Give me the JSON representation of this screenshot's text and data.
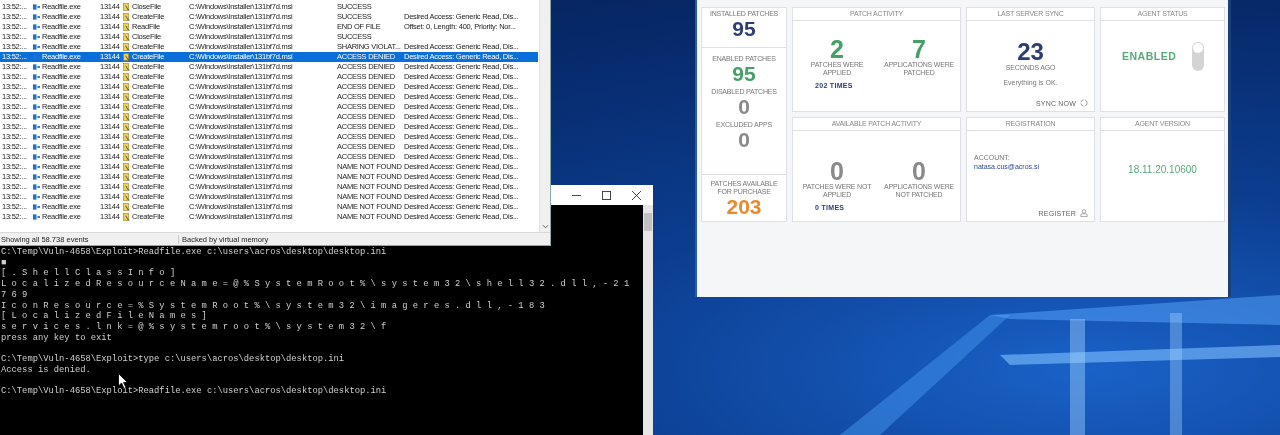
{
  "process_monitor": {
    "rows": [
      {
        "time": "13:52:...",
        "process": "Readfile.exe",
        "pid": "13144",
        "operation": "CloseFile",
        "path": "C:\\Windows\\Installer\\131bf7d.msi",
        "result": "SUCCESS",
        "selected": false
      },
      {
        "time": "13:52:...",
        "process": "Readfile.exe",
        "pid": "13144",
        "operation": "CreateFile",
        "path": "C:\\Windows\\Installer\\131bf7d.msi",
        "result": "SUCCESS",
        "detail": "Desired Access: Generic Read, Dis...",
        "selected": false
      },
      {
        "time": "13:52:...",
        "process": "Readfile.exe",
        "pid": "13144",
        "operation": "ReadFile",
        "path": "C:\\Windows\\Installer\\131bf7d.msi",
        "result": "END OF FILE",
        "detail": "Offset: 0, Length: 400, Priority: Nor...",
        "selected": false
      },
      {
        "time": "13:52:...",
        "process": "Readfile.exe",
        "pid": "13144",
        "operation": "CloseFile",
        "path": "C:\\Windows\\Installer\\131bf7d.msi",
        "result": "SUCCESS",
        "selected": false
      },
      {
        "time": "13:52:...",
        "process": "Readfile.exe",
        "pid": "13144",
        "operation": "CreateFile",
        "path": "C:\\Windows\\Installer\\131bf7d.msi",
        "result": "SHARING VIOLAT...",
        "detail": "Desired Access: Generic Read, Dis...",
        "selected": false
      },
      {
        "time": "13:52:...",
        "process": "Readfile.exe",
        "pid": "13144",
        "operation": "CreateFile",
        "path": "C:\\Windows\\Installer\\131bf7d.msi",
        "result": "ACCESS DENIED",
        "detail": "Desired Access: Generic Read, Dis...",
        "selected": true
      },
      {
        "time": "13:52:...",
        "process": "Readfile.exe",
        "pid": "13144",
        "operation": "CreateFile",
        "path": "C:\\Windows\\Installer\\131bf7d.msi",
        "result": "ACCESS DENIED",
        "detail": "Desired Access: Generic Read, Dis...",
        "selected": false
      },
      {
        "time": "13:52:...",
        "process": "Readfile.exe",
        "pid": "13144",
        "operation": "CreateFile",
        "path": "C:\\Windows\\Installer\\131bf7d.msi",
        "result": "ACCESS DENIED",
        "detail": "Desired Access: Generic Read, Dis...",
        "selected": false
      },
      {
        "time": "13:52:...",
        "process": "Readfile.exe",
        "pid": "13144",
        "operation": "CreateFile",
        "path": "C:\\Windows\\Installer\\131bf7d.msi",
        "result": "ACCESS DENIED",
        "detail": "Desired Access: Generic Read, Dis...",
        "selected": false
      },
      {
        "time": "13:52:...",
        "process": "Readfile.exe",
        "pid": "13144",
        "operation": "CreateFile",
        "path": "C:\\Windows\\Installer\\131bf7d.msi",
        "result": "ACCESS DENIED",
        "detail": "Desired Access: Generic Read, Dis...",
        "selected": false
      },
      {
        "time": "13:52:...",
        "process": "Readfile.exe",
        "pid": "13144",
        "operation": "CreateFile",
        "path": "C:\\Windows\\Installer\\131bf7d.msi",
        "result": "ACCESS DENIED",
        "detail": "Desired Access: Generic Read, Dis...",
        "selected": false
      },
      {
        "time": "13:52:...",
        "process": "Readfile.exe",
        "pid": "13144",
        "operation": "CreateFile",
        "path": "C:\\Windows\\Installer\\131bf7d.msi",
        "result": "ACCESS DENIED",
        "detail": "Desired Access: Generic Read, Dis...",
        "selected": false
      },
      {
        "time": "13:52:...",
        "process": "Readfile.exe",
        "pid": "13144",
        "operation": "CreateFile",
        "path": "C:\\Windows\\Installer\\131bf7d.msi",
        "result": "ACCESS DENIED",
        "detail": "Desired Access: Generic Read, Dis...",
        "selected": false
      },
      {
        "time": "13:52:...",
        "process": "Readfile.exe",
        "pid": "13144",
        "operation": "CreateFile",
        "path": "C:\\Windows\\Installer\\131bf7d.msi",
        "result": "ACCESS DENIED",
        "detail": "Desired Access: Generic Read, Dis...",
        "selected": false
      },
      {
        "time": "13:52:...",
        "process": "Readfile.exe",
        "pid": "13144",
        "operation": "CreateFile",
        "path": "C:\\Windows\\Installer\\131bf7d.msi",
        "result": "ACCESS DENIED",
        "detail": "Desired Access: Generic Read, Dis...",
        "selected": false
      },
      {
        "time": "13:52:...",
        "process": "Readfile.exe",
        "pid": "13144",
        "operation": "CreateFile",
        "path": "C:\\Windows\\Installer\\131bf7d.msi",
        "result": "ACCESS DENIED",
        "detail": "Desired Access: Generic Read, Dis...",
        "selected": false
      },
      {
        "time": "13:52:...",
        "process": "Readfile.exe",
        "pid": "13144",
        "operation": "CreateFile",
        "path": "C:\\Windows\\Installer\\131bf7d.msi",
        "result": "NAME NOT FOUND",
        "detail": "Desired Access: Generic Read, Dis...",
        "selected": false
      },
      {
        "time": "13:52:...",
        "process": "Readfile.exe",
        "pid": "13144",
        "operation": "CreateFile",
        "path": "C:\\Windows\\Installer\\131bf7d.msi",
        "result": "NAME NOT FOUND",
        "detail": "Desired Access: Generic Read, Dis...",
        "selected": false
      },
      {
        "time": "13:52:...",
        "process": "Readfile.exe",
        "pid": "13144",
        "operation": "CreateFile",
        "path": "C:\\Windows\\Installer\\131bf7d.msi",
        "result": "NAME NOT FOUND",
        "detail": "Desired Access: Generic Read, Dis...",
        "selected": false
      },
      {
        "time": "13:52:...",
        "process": "Readfile.exe",
        "pid": "13144",
        "operation": "CreateFile",
        "path": "C:\\Windows\\Installer\\131bf7d.msi",
        "result": "NAME NOT FOUND",
        "detail": "Desired Access: Generic Read, Dis...",
        "selected": false
      },
      {
        "time": "13:52:...",
        "process": "Readfile.exe",
        "pid": "13144",
        "operation": "CreateFile",
        "path": "C:\\Windows\\Installer\\131bf7d.msi",
        "result": "NAME NOT FOUND",
        "detail": "Desired Access: Generic Read, Dis...",
        "selected": false
      },
      {
        "time": "13:52:...",
        "process": "Readfile.exe",
        "pid": "13144",
        "operation": "CreateFile",
        "path": "C:\\Windows\\Installer\\131bf7d.msi",
        "result": "NAME NOT FOUND",
        "detail": "Desired Access: Generic Read, Dis...",
        "selected": false
      }
    ],
    "status_bar": [
      "Showing all 58.738 events",
      "Backed by virtual memory"
    ]
  },
  "command_prompt": {
    "blocks": [
      [
        "C:\\Temp\\Vuln-4658\\Exploit>Readfile.exe c:\\users\\acros\\desktop\\desktop.ini",
        "■",
        "[ . S h e l l C l a s s I n f o ]",
        "L o c a l i z e d R e s o u r c e N a m e = @ % S y s t e m R o o t % \\ s y s t e m 3 2 \\ s h e l l 3 2 . d l l , - 2 1",
        "7 6 9",
        "I c o n R e s o u r c e = % S y s t e m R o o t % \\ s y s t e m 3 2 \\ i m a g e r e s . d l l , - 1 8 3",
        "[ L o c a l i z e d F i l e N a m e s ]",
        "s e r v i c e s . l n k = @ % s y s t e m r o o t % \\ s y s t e m 3 2 \\ f",
        "press any key to exit"
      ],
      [
        "C:\\Temp\\Vuln-4658\\Exploit>type c:\\users\\acros\\desktop\\desktop.ini",
        "Access is denied."
      ],
      [
        "C:\\Temp\\Vuln-4658\\Exploit>Readfile.exe c:\\users\\acros\\desktop\\desktop.ini"
      ]
    ]
  },
  "agent": {
    "summary_sections": [
      {
        "stats": [
          {
            "label": "INSTALLED PATCHES",
            "value": "95",
            "color": "#2c3e6f"
          }
        ]
      },
      {
        "stats": [
          {
            "label": "ENABLED PATCHES",
            "value": "95",
            "color": "#44a066"
          },
          {
            "label": "DISABLED PATCHES",
            "value": "0",
            "color": "#8a8a8a"
          },
          {
            "label": "EXCLUDED APPS",
            "value": "0",
            "color": "#8a8a8a"
          }
        ]
      },
      {
        "stats": [
          {
            "label": "PATCHES AVAILABLE FOR PURCHASE",
            "value": "203",
            "color": "#e88a2e"
          }
        ]
      }
    ],
    "patch_activity": {
      "title": "PATCH ACTIVITY",
      "stats": [
        {
          "value": "2",
          "label": "PATCHES WERE APPLIED",
          "color": "#44a066"
        },
        {
          "value": "7",
          "label": "APPLICATIONS WERE PATCHED",
          "color": "#44a066"
        }
      ],
      "times": "202 TIMES"
    },
    "last_server_sync": {
      "title": "LAST SERVER SYNC",
      "value": "23",
      "unit": "SECONDS AGO",
      "message": "Everything is OK.",
      "action": "SYNC NOW"
    },
    "agent_status": {
      "title": "AGENT STATUS",
      "status": "ENABLED",
      "on": true
    },
    "available_patch_activity": {
      "title": "AVAILABLE PATCH ACTIVITY",
      "stats": [
        {
          "value": "0",
          "label": "PATCHES WERE NOT APPLIED",
          "color": "#8a8a8a"
        },
        {
          "value": "0",
          "label": "APPLICATIONS WERE NOT PATCHED",
          "color": "#8a8a8a"
        }
      ],
      "times": "0 TIMES"
    },
    "registration": {
      "title": "REGISTRATION",
      "account_label": "ACCOUNT:",
      "account": "natasa.cus@acros.si",
      "action": "REGISTER"
    },
    "agent_version": {
      "title": "AGENT VERSION",
      "version": "18.11.20.10600"
    }
  }
}
